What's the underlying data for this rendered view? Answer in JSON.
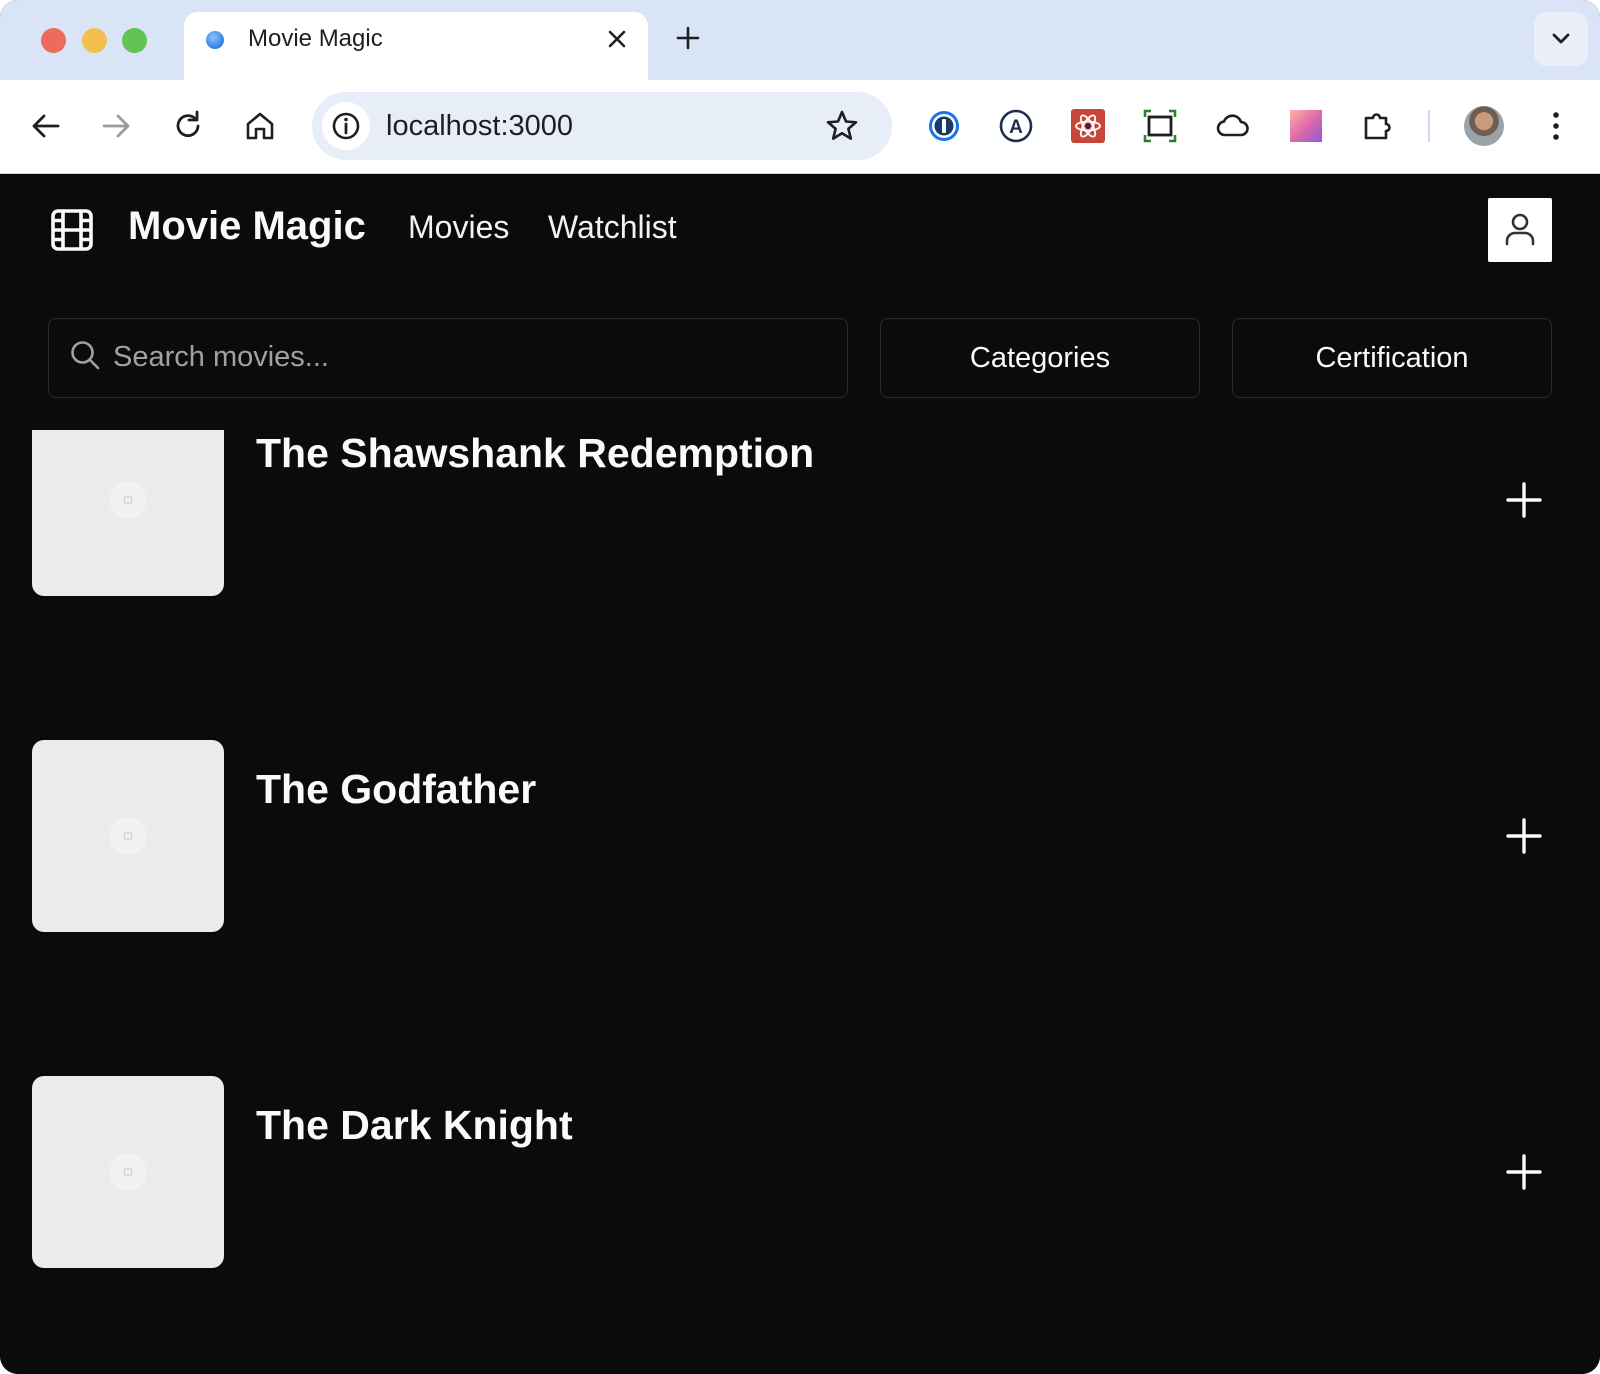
{
  "browser": {
    "tab_title": "Movie Magic",
    "url": "localhost:3000"
  },
  "app": {
    "brand": "Movie Magic",
    "nav": {
      "movies": "Movies",
      "watchlist": "Watchlist"
    },
    "search": {
      "placeholder": "Search movies...",
      "value": ""
    },
    "filters": {
      "categories": "Categories",
      "certification": "Certification"
    },
    "movies": [
      {
        "title": "The Shawshank Redemption"
      },
      {
        "title": "The Godfather"
      },
      {
        "title": "The Dark Knight"
      }
    ]
  },
  "colors": {
    "background": "#0b0b0b",
    "text": "#fafafa",
    "poster_placeholder": "#ebebeb",
    "tabstrip": "#d9e4f7"
  }
}
